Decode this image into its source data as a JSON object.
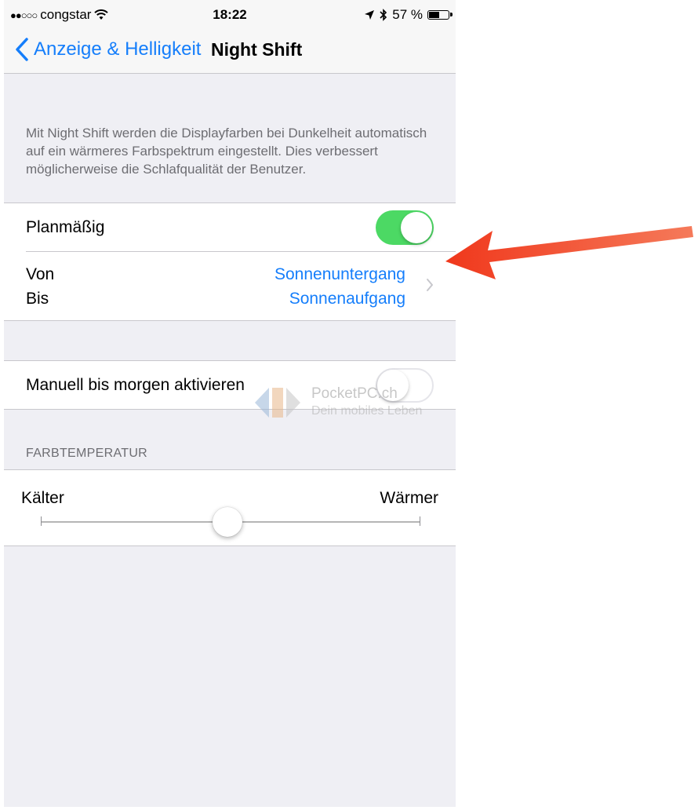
{
  "status_bar": {
    "carrier": "congstar",
    "time": "18:22",
    "battery": "57 %",
    "battery_level": 0.57
  },
  "nav": {
    "back_label": "Anzeige & Helligkeit",
    "title": "Night Shift"
  },
  "description": "Mit Night Shift werden die Displayfarben bei Dunkelheit automatisch auf ein wärmeres Farbspektrum eingestellt. Dies verbessert möglicherweise die Schlafqualität der Benutzer.",
  "schedule": {
    "label": "Planmäßig",
    "enabled": true,
    "from_label": "Von",
    "from_value": "Sonnenuntergang",
    "to_label": "Bis",
    "to_value": "Sonnenaufgang"
  },
  "manual": {
    "label": "Manuell bis morgen aktivieren",
    "enabled": false
  },
  "temperature": {
    "header": "FARBTEMPERATUR",
    "min_label": "Kälter",
    "max_label": "Wärmer",
    "value": 0.5
  },
  "watermark": {
    "brand": "PocketPC.ch",
    "tagline": "Dein mobiles Leben"
  },
  "colors": {
    "accent": "#157efb",
    "toggle_on": "#4cd964",
    "arrow": "#f0381c"
  }
}
